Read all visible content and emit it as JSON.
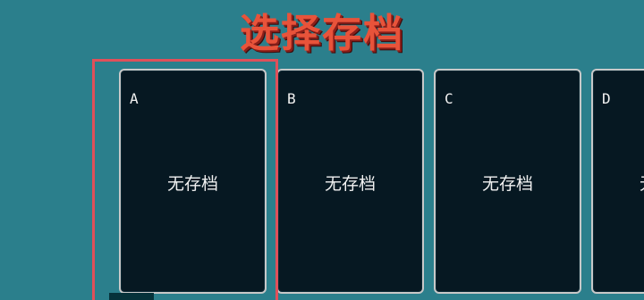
{
  "title": "选择存档",
  "colors": {
    "background": "#2b7f8c",
    "title": "#e8533a",
    "card": "#061822",
    "card_border": "#c8c8c8",
    "selection": "#e0505a",
    "text": "#f2f2f2"
  },
  "selected_slot": "A",
  "slots": [
    {
      "letter": "A",
      "status": "无存档"
    },
    {
      "letter": "B",
      "status": "无存档"
    },
    {
      "letter": "C",
      "status": "无存档"
    },
    {
      "letter": "D",
      "status": "无存档"
    }
  ]
}
